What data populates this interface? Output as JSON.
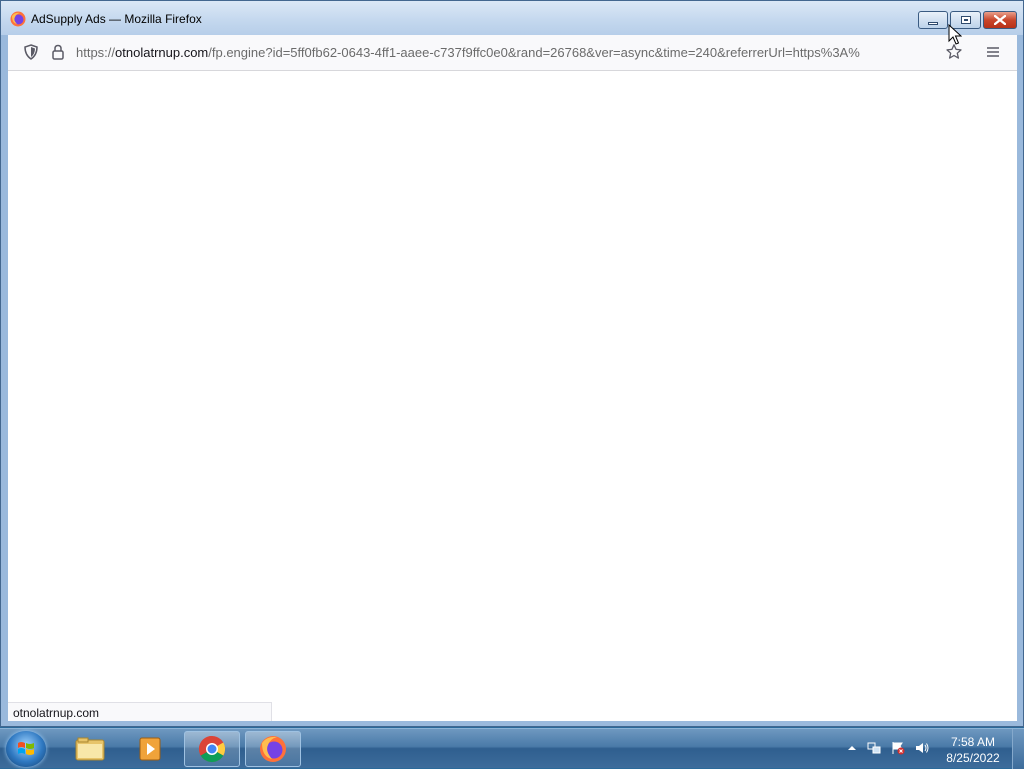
{
  "window": {
    "title": "AdSupply Ads — Mozilla Firefox",
    "controls": {
      "minimize": "minimize",
      "maximize": "maximize",
      "close": "close"
    }
  },
  "navbar": {
    "url_scheme": "https://",
    "url_host": "otnolatrnup.com",
    "url_path": "/fp.engine?id=5ff0fb62-0643-4ff1-aaee-c737f9ffc0e0&rand=26768&ver=async&time=240&referrerUrl=https%3A%",
    "icons": [
      "shield-icon",
      "lock-icon",
      "star-icon",
      "menu-icon"
    ]
  },
  "status": {
    "text": "otnolatrnup.com"
  },
  "taskbar": {
    "items": [
      "start-button",
      "file-explorer",
      "media-player",
      "chrome",
      "firefox"
    ],
    "clock": {
      "time": "7:58 AM",
      "date": "8/25/2022"
    }
  }
}
